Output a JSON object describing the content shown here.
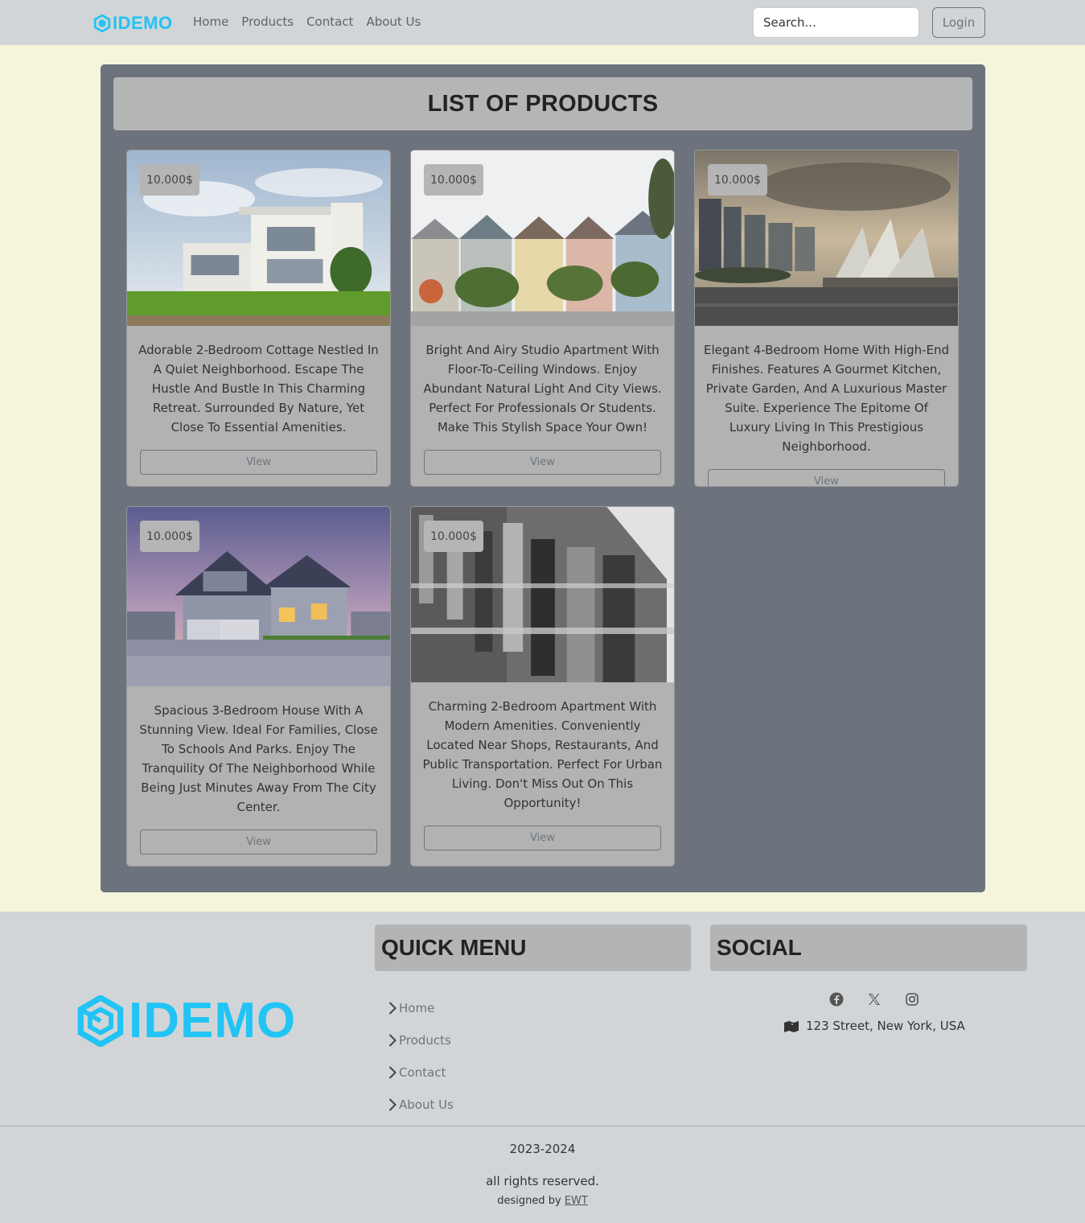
{
  "navbar": {
    "brand": "IDEMO",
    "links": [
      "Home",
      "Products",
      "Contact",
      "About Us"
    ],
    "search_placeholder": "Search...",
    "login_label": "Login"
  },
  "main": {
    "title": "LIST OF PRODUCTS",
    "products": [
      {
        "price": "10.000$",
        "image": "modern-white-villa",
        "description": "Adorable 2-Bedroom Cottage Nestled In A Quiet Neighborhood. Escape The Hustle And Bustle In This Charming Retreat. Surrounded By Nature, Yet Close To Essential Amenities.",
        "button": "View"
      },
      {
        "price": "10.000$",
        "image": "painted-ladies-row-houses",
        "description": "Bright And Airy Studio Apartment With Floor-To-Ceiling Windows. Enjoy Abundant Natural Light And City Views. Perfect For Professionals Or Students. Make This Stylish Space Your Own!",
        "button": "View"
      },
      {
        "price": "10.000$",
        "image": "sydney-opera-house",
        "description": "Elegant 4-Bedroom Home With High-End Finishes. Features A Gourmet Kitchen, Private Garden, And A Luxurious Master Suite. Experience The Epitome Of Luxury Living In This Prestigious Neighborhood.",
        "button": "View"
      },
      {
        "price": "10.000$",
        "image": "suburban-house-at-dusk",
        "description": "Spacious 3-Bedroom House With A Stunning View. Ideal For Families, Close To Schools And Parks. Enjoy The Tranquility Of The Neighborhood While Being Just Minutes Away From The City Center.",
        "button": "View"
      },
      {
        "price": "10.000$",
        "image": "grey-facade-building",
        "description": "Charming 2-Bedroom Apartment With Modern Amenities. Conveniently Located Near Shops, Restaurants, And Public Transportation. Perfect For Urban Living. Don't Miss Out On This Opportunity!",
        "button": "View"
      }
    ]
  },
  "footer": {
    "brand": "IDEMO",
    "quick_menu": {
      "title": "QUICK MENU",
      "items": [
        "Home",
        "Products",
        "Contact",
        "About Us"
      ]
    },
    "social": {
      "title": "SOCIAL",
      "icons": [
        "facebook-icon",
        "x-twitter-icon",
        "instagram-icon"
      ],
      "address": "123 Street, New York, USA"
    },
    "years": "2023-2024",
    "rights": "all rights reserved.",
    "designed_by": "designed by",
    "designer": "EWT"
  },
  "colors": {
    "brand": "#22c3f5",
    "page_bg": "#f5f5dc",
    "nav_bg": "#d2d5d7",
    "panel_bg": "#6c737d",
    "card_bg": "#b2b2b2"
  }
}
